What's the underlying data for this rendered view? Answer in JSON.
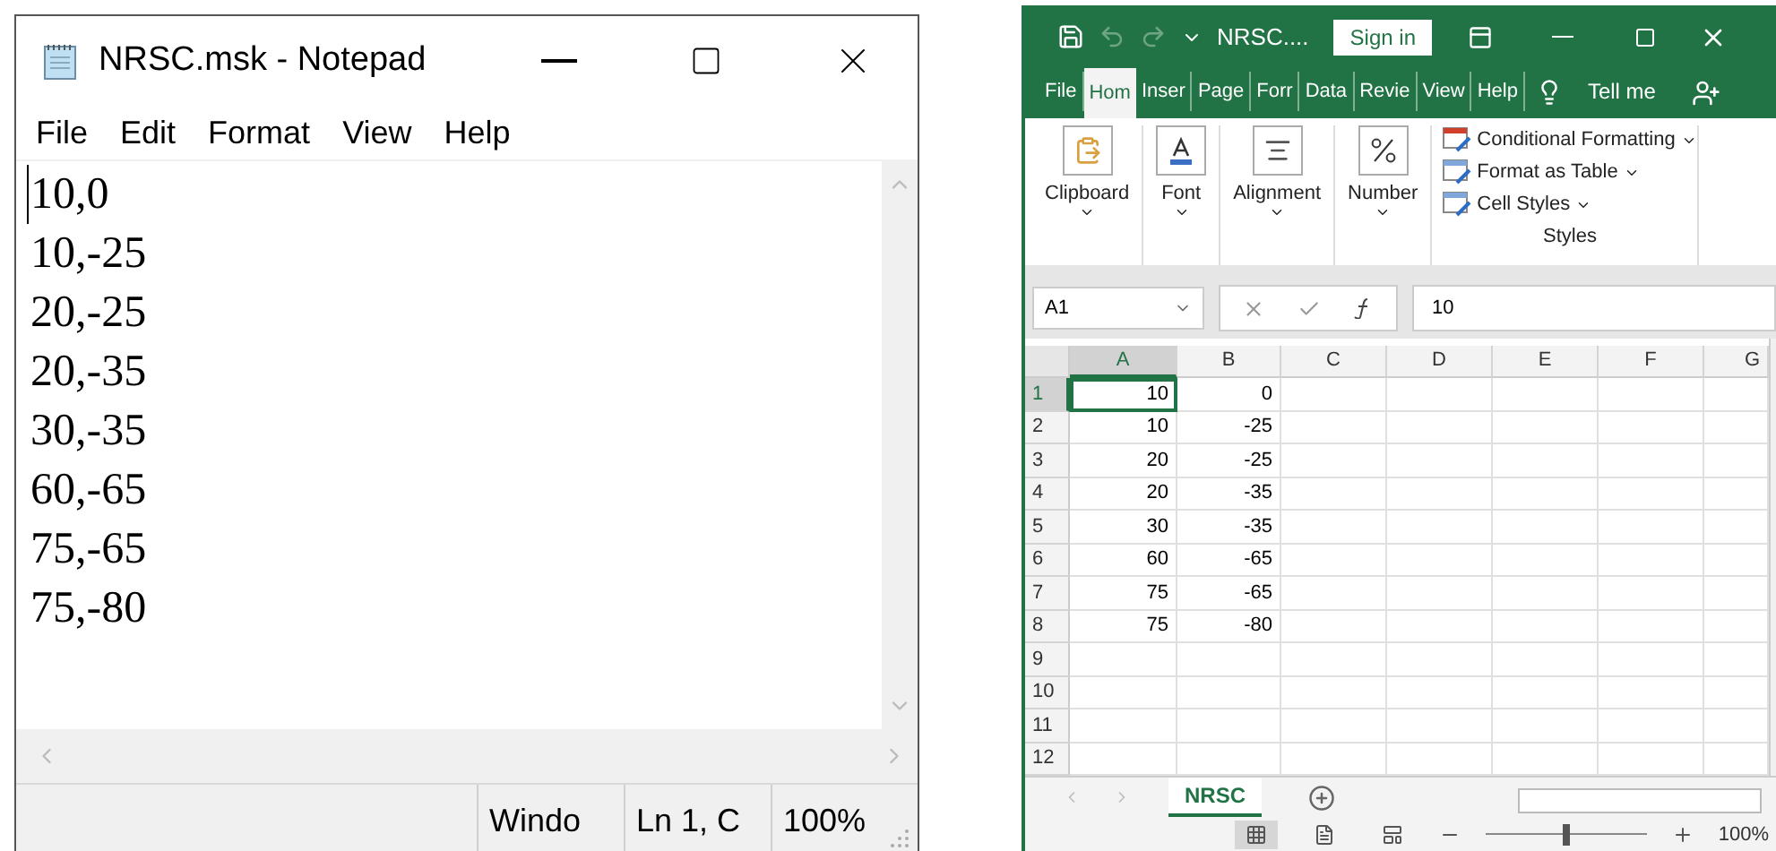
{
  "notepad": {
    "title": "NRSC.msk - Notepad",
    "menu": [
      {
        "label": "File"
      },
      {
        "label": "Edit"
      },
      {
        "label": "Format"
      },
      {
        "label": "View"
      },
      {
        "label": "Help"
      }
    ],
    "lines": [
      "10,0",
      "10,-25",
      "20,-25",
      "20,-35",
      "30,-35",
      "60,-65",
      "75,-65",
      "75,-80"
    ],
    "status_bar": [
      "Windo",
      "Ln 1, C",
      "100%"
    ]
  },
  "excel": {
    "file_name": "NRSC....",
    "sign_in": "Sign in",
    "tabs": [
      {
        "label": "File",
        "selected": false
      },
      {
        "label": "Hom",
        "selected": true
      },
      {
        "label": "Inser",
        "selected": false
      },
      {
        "label": "Page",
        "selected": false
      },
      {
        "label": "Forr",
        "selected": false
      },
      {
        "label": "Data",
        "selected": false
      },
      {
        "label": "Revie",
        "selected": false
      },
      {
        "label": "View",
        "selected": false
      },
      {
        "label": "Help",
        "selected": false
      }
    ],
    "tell_me": "Tell me",
    "ribbon_groups": [
      {
        "kind": "paste",
        "label": "Clipboard"
      },
      {
        "kind": "font",
        "label": "Font"
      },
      {
        "kind": "align",
        "label": "Alignment"
      },
      {
        "kind": "percent",
        "label": "Number"
      }
    ],
    "styles": {
      "label": "Styles",
      "items": [
        "Conditional Formatting",
        "Format as Table",
        "Cell Styles"
      ]
    },
    "name_box": "A1",
    "formula": "10",
    "columns": [
      {
        "label": "A",
        "selected": true
      },
      {
        "label": "B",
        "selected": false
      },
      {
        "label": "C",
        "selected": false
      },
      {
        "label": "D",
        "selected": false
      },
      {
        "label": "E",
        "selected": false
      },
      {
        "label": "F",
        "selected": false
      },
      {
        "label": "G",
        "selected": false
      }
    ],
    "rows": [
      {
        "number": "1",
        "selected": true,
        "cells": [
          "10",
          "0"
        ]
      },
      {
        "number": "2",
        "selected": false,
        "cells": [
          "10",
          "-25"
        ]
      },
      {
        "number": "3",
        "selected": false,
        "cells": [
          "20",
          "-25"
        ]
      },
      {
        "number": "4",
        "selected": false,
        "cells": [
          "20",
          "-35"
        ]
      },
      {
        "number": "5",
        "selected": false,
        "cells": [
          "30",
          "-35"
        ]
      },
      {
        "number": "6",
        "selected": false,
        "cells": [
          "60",
          "-65"
        ]
      },
      {
        "number": "7",
        "selected": false,
        "cells": [
          "75",
          "-65"
        ]
      },
      {
        "number": "8",
        "selected": false,
        "cells": [
          "75",
          "-80"
        ]
      },
      {
        "number": "9",
        "selected": false,
        "cells": []
      },
      {
        "number": "10",
        "selected": false,
        "cells": []
      },
      {
        "number": "11",
        "selected": false,
        "cells": []
      },
      {
        "number": "12",
        "selected": false,
        "cells": []
      }
    ],
    "sheets": [
      {
        "label": "NRSC",
        "selected": true
      }
    ],
    "zoom": {
      "level": 0.5,
      "reading": "100%"
    }
  }
}
